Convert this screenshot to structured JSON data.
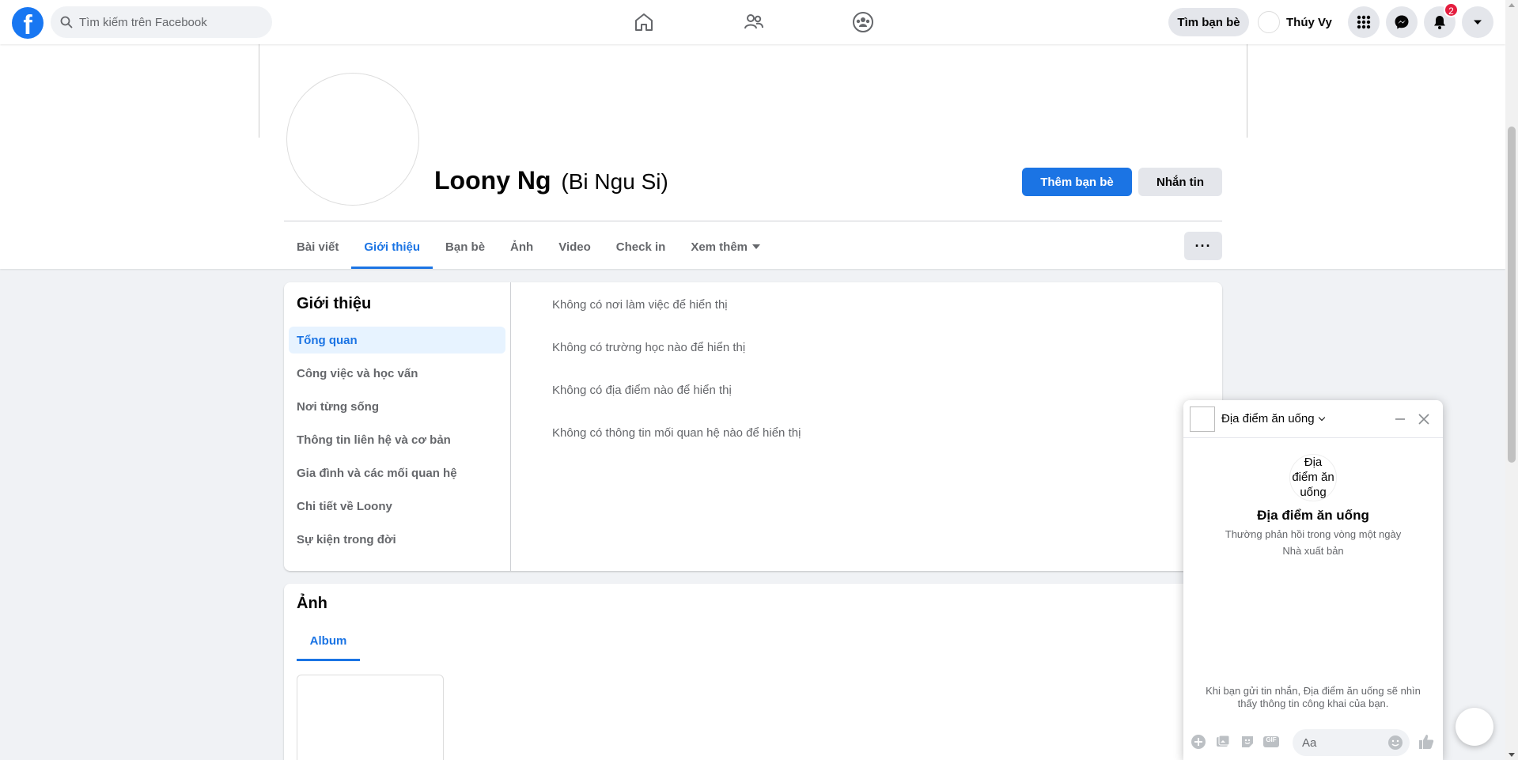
{
  "topbar": {
    "logo_letter": "f",
    "search_placeholder": "Tìm kiếm trên Facebook",
    "find_friends": "Tìm bạn bè",
    "user_name": "Thúy Vy",
    "notification_count": "2"
  },
  "profile": {
    "name": "Loony Ng",
    "alt_name": "(Bi Ngu Si)",
    "add_friend": "Thêm bạn bè",
    "message": "Nhắn tin",
    "more_dots": "···"
  },
  "tabs": [
    {
      "label": "Bài viết"
    },
    {
      "label": "Giới thiệu"
    },
    {
      "label": "Bạn bè"
    },
    {
      "label": "Ảnh"
    },
    {
      "label": "Video"
    },
    {
      "label": "Check in"
    },
    {
      "label": "Xem thêm"
    }
  ],
  "about": {
    "title": "Giới thiệu",
    "nav": [
      {
        "label": "Tổng quan"
      },
      {
        "label": "Công việc và học vấn"
      },
      {
        "label": "Nơi từng sống"
      },
      {
        "label": "Thông tin liên hệ và cơ bản"
      },
      {
        "label": "Gia đình và các mối quan hệ"
      },
      {
        "label": "Chi tiết về Loony"
      },
      {
        "label": "Sự kiện trong đời"
      }
    ],
    "rows": [
      {
        "text": "Không có nơi làm việc để hiển thị"
      },
      {
        "text": "Không có trường học nào để hiển thị"
      },
      {
        "text": "Không có địa điểm nào để hiển thị"
      },
      {
        "text": "Không có thông tin mối quan hệ nào để hiển thị"
      }
    ]
  },
  "photos": {
    "title": "Ảnh",
    "album_tab": "Album"
  },
  "chat": {
    "name": "Địa điểm ăn uống",
    "pic_alt": "Địa điểm ăn uống",
    "title": "Địa điểm ăn uống",
    "response": "Thường phản hồi trong vòng một ngày",
    "role": "Nhà xuất bản",
    "note": "Khi bạn gửi tin nhắn, Địa điểm ăn uống sẽ nhìn thấy thông tin công khai của bạn.",
    "input_placeholder": "Aa",
    "gif_label": "GIF"
  },
  "colors": {
    "brand": "#1877f2",
    "accent": "#1b74e4",
    "badge": "#e41e3f"
  }
}
